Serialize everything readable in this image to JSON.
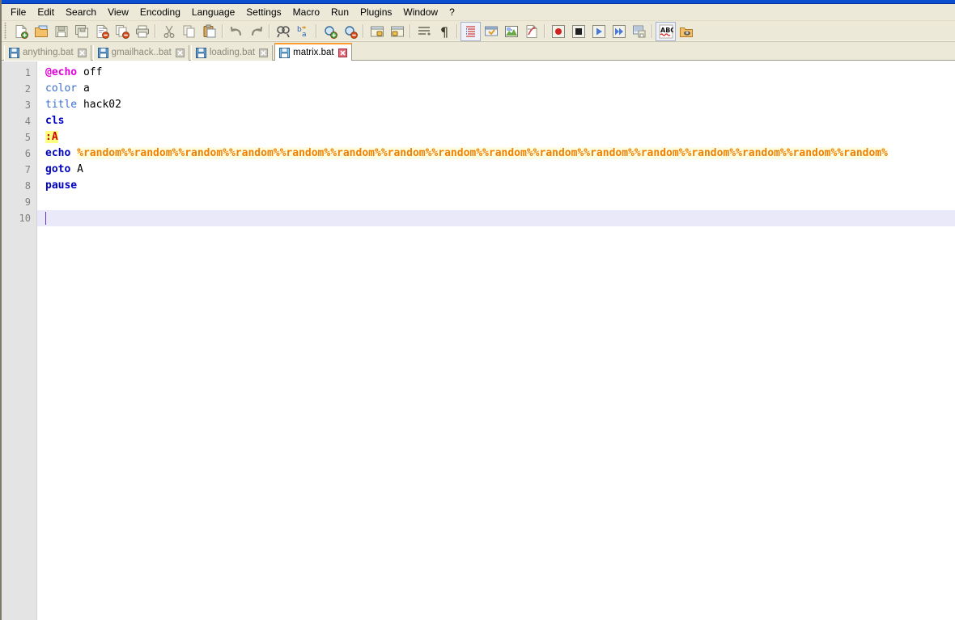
{
  "window": {
    "title_bar_color": "#0b4ecf",
    "chrome_color": "#ece9d8"
  },
  "menubar": {
    "items": [
      {
        "label": "File",
        "name": "menu-file"
      },
      {
        "label": "Edit",
        "name": "menu-edit"
      },
      {
        "label": "Search",
        "name": "menu-search"
      },
      {
        "label": "View",
        "name": "menu-view"
      },
      {
        "label": "Encoding",
        "name": "menu-encoding"
      },
      {
        "label": "Language",
        "name": "menu-language"
      },
      {
        "label": "Settings",
        "name": "menu-settings"
      },
      {
        "label": "Macro",
        "name": "menu-macro"
      },
      {
        "label": "Run",
        "name": "menu-run"
      },
      {
        "label": "Plugins",
        "name": "menu-plugins"
      },
      {
        "label": "Window",
        "name": "menu-window"
      },
      {
        "label": "?",
        "name": "menu-help"
      }
    ]
  },
  "toolbar": {
    "buttons": [
      {
        "icon": "new-file-icon",
        "label": "New"
      },
      {
        "icon": "open-file-icon",
        "label": "Open"
      },
      {
        "icon": "save-icon",
        "label": "Save"
      },
      {
        "icon": "save-all-icon",
        "label": "Save All"
      },
      {
        "icon": "close-file-icon",
        "label": "Close"
      },
      {
        "icon": "close-all-icon",
        "label": "Close All"
      },
      {
        "icon": "print-icon",
        "label": "Print"
      },
      {
        "icon": "separator",
        "label": ""
      },
      {
        "icon": "cut-icon",
        "label": "Cut"
      },
      {
        "icon": "copy-icon",
        "label": "Copy"
      },
      {
        "icon": "paste-icon",
        "label": "Paste"
      },
      {
        "icon": "separator",
        "label": ""
      },
      {
        "icon": "undo-icon",
        "label": "Undo"
      },
      {
        "icon": "redo-icon",
        "label": "Redo"
      },
      {
        "icon": "separator",
        "label": ""
      },
      {
        "icon": "find-icon",
        "label": "Find"
      },
      {
        "icon": "replace-icon",
        "label": "Replace"
      },
      {
        "icon": "separator",
        "label": ""
      },
      {
        "icon": "zoom-in-icon",
        "label": "Zoom In"
      },
      {
        "icon": "zoom-out-icon",
        "label": "Zoom Out"
      },
      {
        "icon": "separator",
        "label": ""
      },
      {
        "icon": "sync-vertical-icon",
        "label": "Sync Vertical Scrolling"
      },
      {
        "icon": "sync-horizontal-icon",
        "label": "Sync Horizontal Scrolling"
      },
      {
        "icon": "separator",
        "label": ""
      },
      {
        "icon": "word-wrap-icon",
        "label": "Word Wrap"
      },
      {
        "icon": "show-all-chars-icon",
        "label": "Show All Characters"
      },
      {
        "icon": "separator",
        "label": ""
      },
      {
        "icon": "indent-guide-icon",
        "label": "Indent Guideline"
      },
      {
        "icon": "user-defined-icon",
        "label": "User Defined Dialogue"
      },
      {
        "icon": "doc-map-icon",
        "label": "Document Map"
      },
      {
        "icon": "function-list-icon",
        "label": "Function List"
      },
      {
        "icon": "separator",
        "label": ""
      },
      {
        "icon": "record-macro-icon",
        "label": "Start Recording"
      },
      {
        "icon": "stop-macro-icon",
        "label": "Stop Recording"
      },
      {
        "icon": "play-macro-icon",
        "label": "Playback"
      },
      {
        "icon": "run-macro-multi-icon",
        "label": "Run Macro Multiple Times"
      },
      {
        "icon": "save-macro-icon",
        "label": "Save Current Macro"
      },
      {
        "icon": "separator",
        "label": ""
      },
      {
        "icon": "spell-check-icon",
        "label": "Spell Check"
      },
      {
        "icon": "run-icon",
        "label": "Run"
      }
    ]
  },
  "tabs": [
    {
      "label": "anything.bat",
      "active": false,
      "name": "tab-anything-bat"
    },
    {
      "label": "gmailhack..bat",
      "active": false,
      "name": "tab-gmailhack-bat"
    },
    {
      "label": "loading.bat",
      "active": false,
      "name": "tab-loading-bat"
    },
    {
      "label": "matrix.bat",
      "active": true,
      "name": "tab-matrix-bat"
    }
  ],
  "editor": {
    "current_line": 10,
    "line_numbers": [
      1,
      2,
      3,
      4,
      5,
      6,
      7,
      8,
      9,
      10
    ],
    "lines": [
      {
        "n": 1,
        "tokens": [
          {
            "t": "@echo",
            "c": "at"
          },
          {
            "t": " off",
            "c": "plain"
          }
        ]
      },
      {
        "n": 2,
        "tokens": [
          {
            "t": "color",
            "c": "kw"
          },
          {
            "t": " a",
            "c": "plain"
          }
        ]
      },
      {
        "n": 3,
        "tokens": [
          {
            "t": "title",
            "c": "kw"
          },
          {
            "t": " hack02",
            "c": "plain"
          }
        ]
      },
      {
        "n": 4,
        "tokens": [
          {
            "t": "cls",
            "c": "cmd"
          }
        ]
      },
      {
        "n": 5,
        "tokens": [
          {
            "t": ":A",
            "c": "label"
          }
        ]
      },
      {
        "n": 6,
        "tokens": [
          {
            "t": "echo",
            "c": "cmd"
          },
          {
            "t": " ",
            "c": "plain"
          },
          {
            "t": "%random%%random%%random%%random%%random%%random%%random%%random%%random%%random%%random%%random%%random%%random%%random%%random%",
            "c": "var"
          }
        ]
      },
      {
        "n": 7,
        "tokens": [
          {
            "t": "goto",
            "c": "cmd"
          },
          {
            "t": " A",
            "c": "plain"
          }
        ]
      },
      {
        "n": 8,
        "tokens": [
          {
            "t": "pause",
            "c": "cmd"
          }
        ]
      },
      {
        "n": 9,
        "tokens": []
      },
      {
        "n": 10,
        "tokens": []
      }
    ],
    "colors": {
      "command": "#0000c0",
      "keyword": "#3c6fd0",
      "at_echo": "#e000d8",
      "label_text": "#d00000",
      "label_highlight": "#ffff80",
      "variable": "#f08000",
      "variable_background": "#fdfde4",
      "current_line_highlight": "#e9e9fa",
      "caret": "#7030c0",
      "gutter_background": "#e4e4e4",
      "gutter_text": "#808080"
    }
  }
}
